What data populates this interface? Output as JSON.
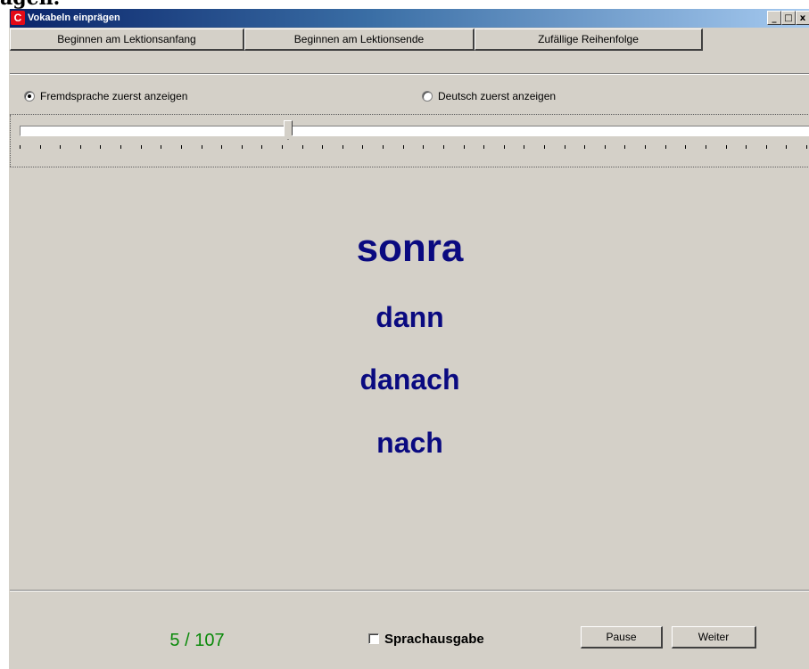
{
  "page": {
    "top_text": "ägen."
  },
  "window": {
    "title": "Vokabeln einprägen",
    "icon": "C",
    "controls": {
      "minimize": "_",
      "maximize": "□",
      "close": "x"
    }
  },
  "toolbar": {
    "buttons": [
      {
        "label": "Beginnen am Lektionsanfang"
      },
      {
        "label": "Beginnen am Lektionsende"
      },
      {
        "label": "Zufällige Reihenfolge"
      }
    ]
  },
  "options": {
    "radio_foreign": {
      "label": "Fremdsprache zuerst anzeigen",
      "checked": true
    },
    "radio_german": {
      "label": "Deutsch zuerst anzeigen",
      "checked": false
    }
  },
  "slider": {
    "position_fraction": 0.34,
    "tick_count": 40
  },
  "vocab": {
    "word": "sonra",
    "translations": [
      "dann",
      "danach",
      "nach"
    ]
  },
  "status": {
    "counter": "5 / 107",
    "speech_output_label": "Sprachausgabe",
    "speech_output_checked": false,
    "pause_label": "Pause",
    "next_label": "Weiter"
  },
  "colors": {
    "word": "#0a0a80",
    "counter": "#0a8a0a",
    "window_bg": "#d4d0c8",
    "titlebar_start": "#0a246a",
    "titlebar_end": "#a6caf0",
    "app_icon": "#e30a17"
  },
  "icons": {
    "app": "turkish-flag-icon",
    "minimize": "minimize-icon",
    "maximize": "maximize-icon",
    "close": "close-icon",
    "slider_thumb": "slider-thumb-icon"
  }
}
